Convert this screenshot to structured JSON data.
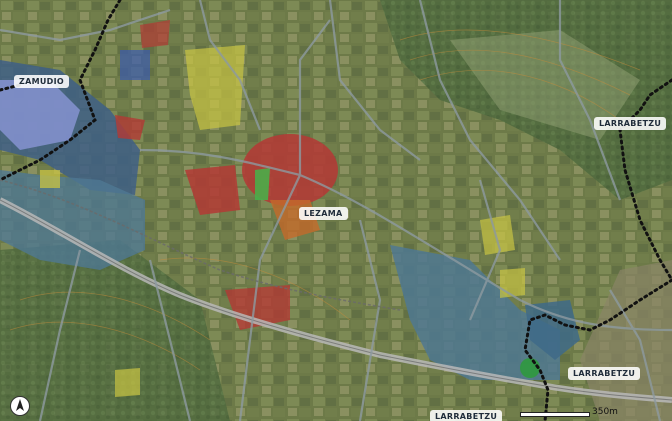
{
  "labels": {
    "zamudio": "ZAMUDIO",
    "lezama": "LEZAMA",
    "larrabetzu_ne": "LARRABETZU",
    "larrabetzu_se": "LARRABETZU",
    "larrabetzu_s": "LARRABETZU"
  },
  "scale": {
    "label": "350m"
  },
  "colors": {
    "base_green": "#6f7a4c",
    "urban_red": "#b33a35",
    "industrial_blue": "#3e5f86",
    "blue_zone": "#4f7892",
    "yellow_zone": "#c9c443",
    "border": "#111111"
  },
  "icons": {
    "north": "north-arrow-icon"
  }
}
